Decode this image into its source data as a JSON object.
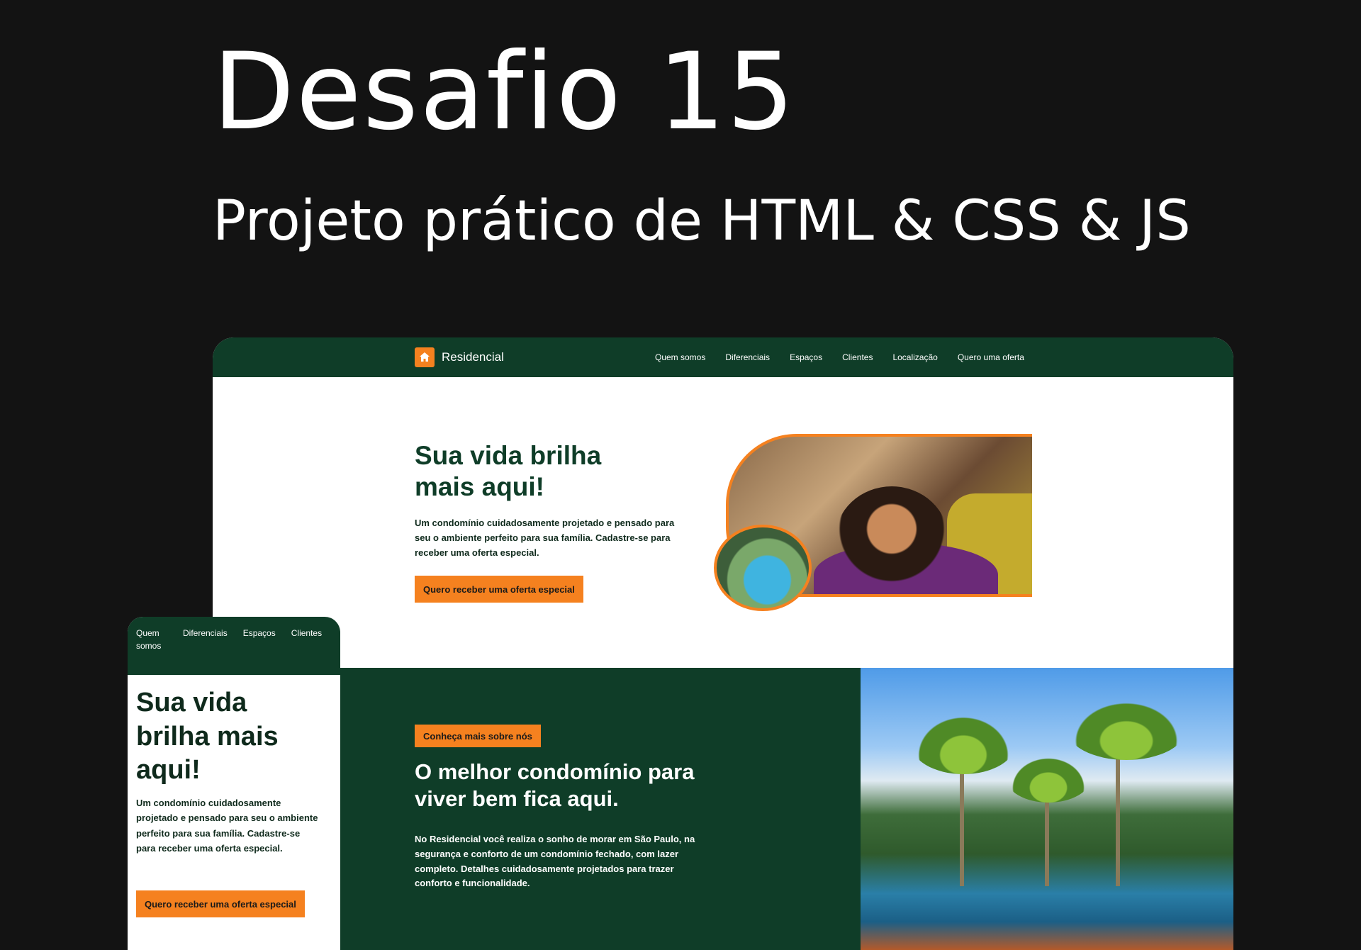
{
  "heading": {
    "title": "Desafio 15",
    "subtitle": "Projeto prático de HTML & CSS & JS"
  },
  "colors": {
    "brand_green": "#0f3d28",
    "accent_orange": "#f5811f",
    "background": "#131313"
  },
  "desktop": {
    "logo": {
      "icon": "house-icon",
      "text": "Residencial"
    },
    "nav": [
      "Quem somos",
      "Diferenciais",
      "Espaços",
      "Clientes",
      "Localização",
      "Quero uma oferta"
    ],
    "hero": {
      "title": "Sua vida brilha mais aqui!",
      "text": "Um condomínio cuidadosamente projetado e pensado para seu o ambiente perfeito para sua família. Cadastre-se para receber uma oferta especial.",
      "button": "Quero receber uma oferta especial"
    },
    "about": {
      "tag": "Conheça mais sobre nós",
      "title": "O melhor condomínio para viver bem fica aqui.",
      "text": "No Residencial você realiza o sonho de morar em São Paulo, na segurança e conforto de um condomínio fechado, com lazer completo. Detalhes cuidadosamente projetados para trazer conforto e funcionalidade."
    }
  },
  "mobile": {
    "nav": [
      "Quem somos",
      "Diferenciais",
      "Espaços",
      "Clientes"
    ],
    "hero": {
      "title": "Sua vida brilha mais aqui!",
      "text": "Um condomínio cuidadosamente projetado e pensado para seu o ambiente perfeito para sua família. Cadastre-se para receber uma oferta especial.",
      "button": "Quero receber uma oferta especial"
    }
  }
}
